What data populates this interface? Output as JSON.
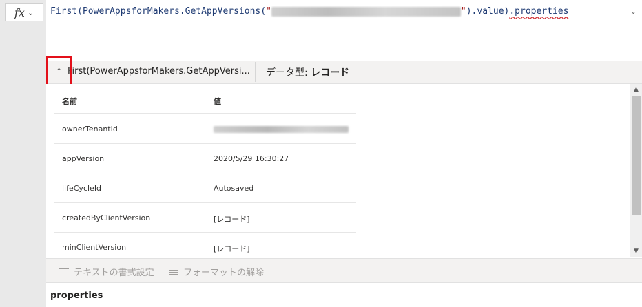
{
  "fx_button": {
    "label": "fx",
    "chevron_icon": "chevron-down-icon"
  },
  "formula": {
    "part1": "First(PowerAppsforMakers.GetAppVersions(",
    "str_open": "\"",
    "str_close": "\"",
    "part2": ").value)",
    "part3": ".properties"
  },
  "result_header": {
    "collapse_icon": "chevron-up-icon",
    "title": "First(PowerAppsforMakers.GetAppVersi...",
    "type_label": "データ型: ",
    "type_value": "レコード"
  },
  "table": {
    "header": {
      "name": "名前",
      "value": "値"
    },
    "rows": [
      {
        "name": "ownerTenantId",
        "value": ""
      },
      {
        "name": "appVersion",
        "value": "2020/5/29 16:30:27"
      },
      {
        "name": "lifeCycleId",
        "value": "Autosaved"
      },
      {
        "name": "createdByClientVersion",
        "value": "[レコード]"
      },
      {
        "name": "minClientVersion",
        "value": "[レコード]"
      }
    ]
  },
  "toolbar": {
    "format_text": "テキストの書式設定",
    "remove_format": "フォーマットの解除"
  },
  "footer": {
    "label": "properties"
  },
  "colors": {
    "highlight": "#e3101a",
    "formula_text": "#1f3b73",
    "string": "#a31515"
  }
}
